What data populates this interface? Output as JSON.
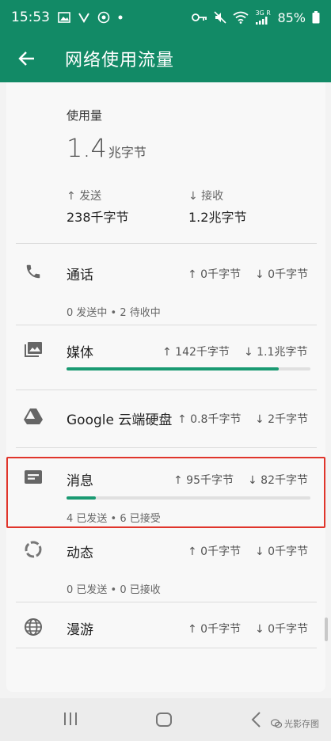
{
  "status_bar": {
    "time": "15:53",
    "network": "3G R",
    "battery": "85%"
  },
  "app_bar": {
    "title": "网络使用流量"
  },
  "summary": {
    "label": "使用量",
    "total_value": "1.4",
    "total_unit": "兆字节",
    "sent_label": "↑ 发送",
    "sent_value": "238千字节",
    "received_label": "↓ 接收",
    "received_value": "1.2兆字节"
  },
  "apps": [
    {
      "name": "通话",
      "icon": "phone-icon",
      "up": "↑ 0千字节",
      "down": "↓ 0千字节",
      "sub": "0 发送中 • 2 待收中"
    },
    {
      "name": "媒体",
      "icon": "photos-icon",
      "up": "↑ 142千字节",
      "down": "↓ 1.1兆字节",
      "progress": 0.87
    },
    {
      "name": "Google 云端硬盘",
      "icon": "drive-icon",
      "up": "↑ 0.8千字节",
      "down": "↓ 2千字节"
    },
    {
      "name": "消息",
      "icon": "message-icon",
      "up": "↑ 95千字节",
      "down": "↓ 82千字节",
      "progress": 0.12,
      "sub": "4 已发送 • 6 已接受"
    },
    {
      "name": "动态",
      "icon": "activity-ring-icon",
      "up": "↑ 0千字节",
      "down": "↓ 0千字节",
      "sub": "0 已发送 • 0 已接收"
    },
    {
      "name": "漫游",
      "icon": "globe-icon",
      "up": "↑ 0千字节",
      "down": "↓ 0千字节"
    }
  ],
  "watermark": "光影存图",
  "colors": {
    "primary": "#128a66",
    "accent": "#1a9a72",
    "highlight": "#e0352b"
  }
}
